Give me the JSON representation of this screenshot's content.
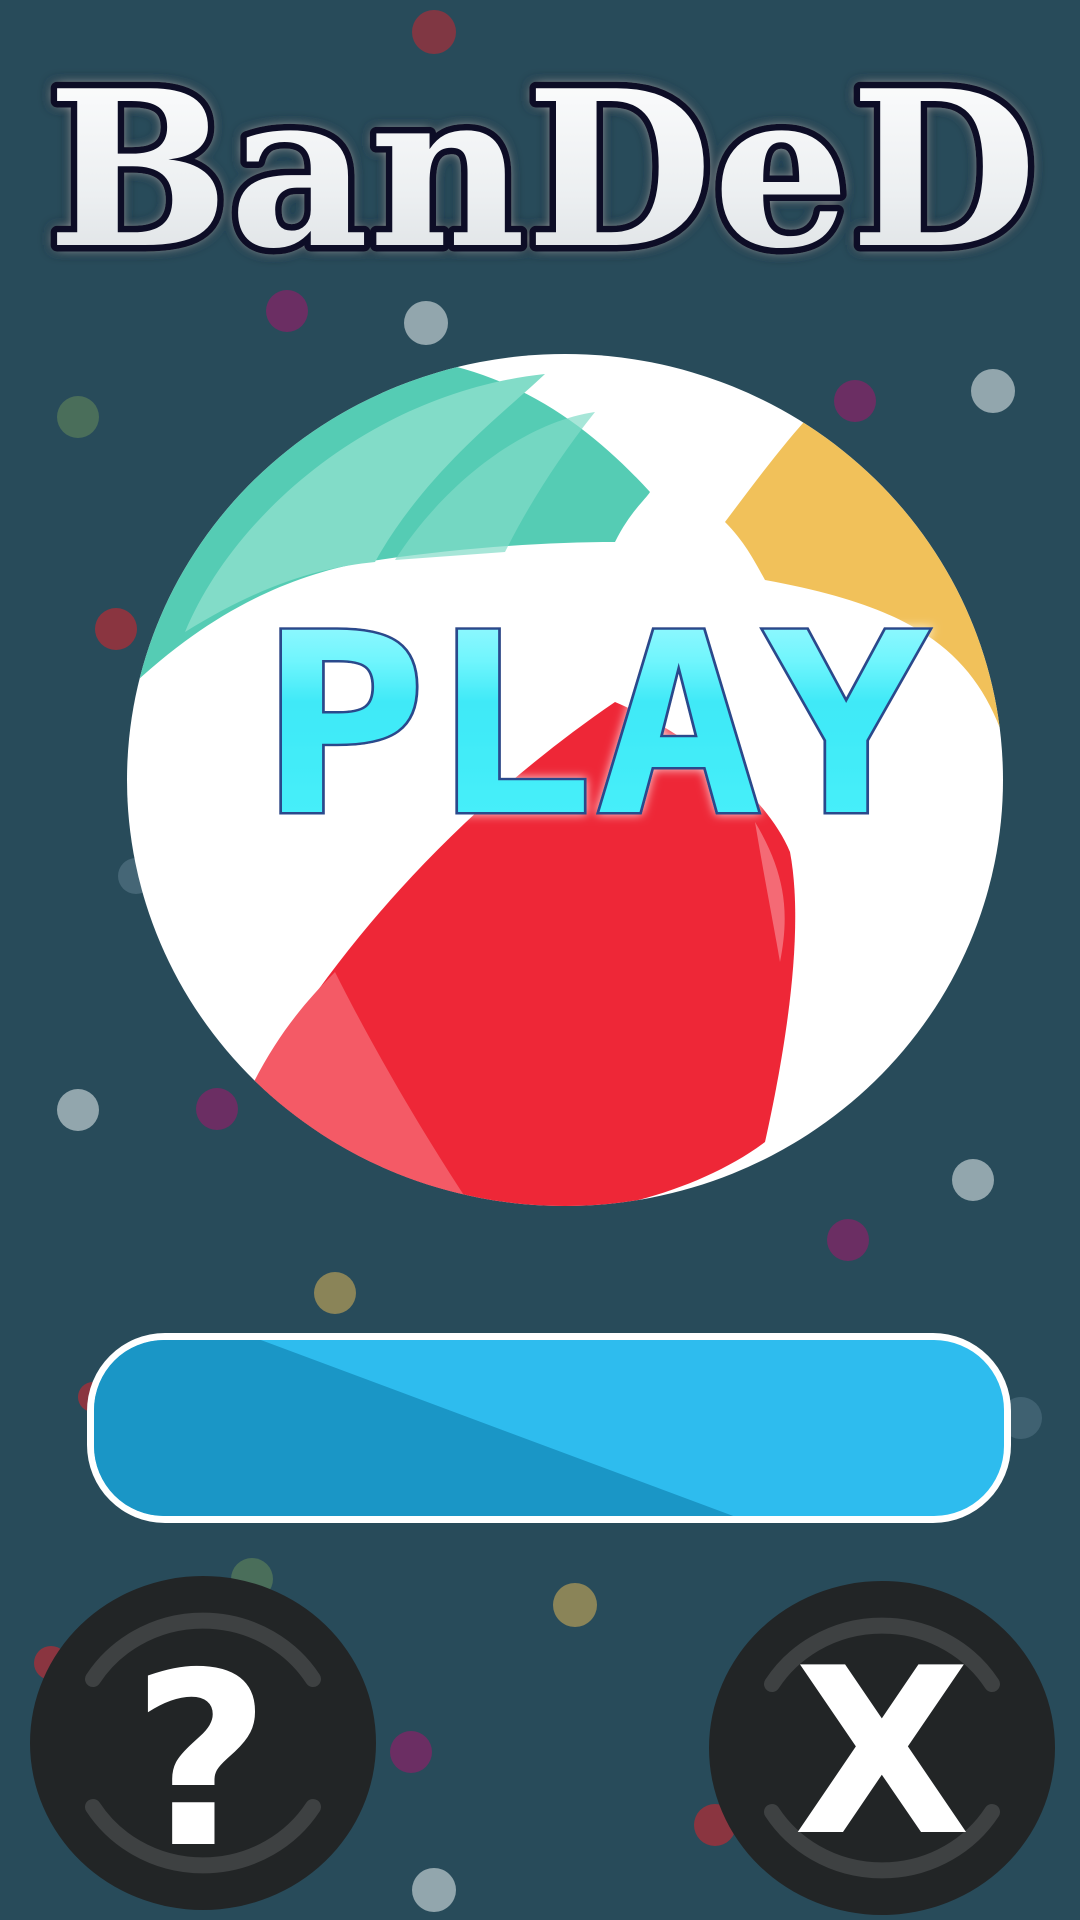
{
  "game": {
    "title": "BanDeD",
    "play_label": "PLAY",
    "help_button_label": "?",
    "close_button_label": "X"
  },
  "colors": {
    "background": "#284b5a",
    "ball_green": "#55ccb4",
    "ball_yellow": "#f1c15a",
    "ball_red": "#ee2737",
    "ball_white": "#ffffff",
    "play_cyan": "#4df3fb",
    "bar_blue": "#2ebcee",
    "bar_dark_blue": "#1a96c6",
    "button_dark": "#222526"
  },
  "icons": {
    "help": "question-mark-icon",
    "close": "x-icon"
  }
}
